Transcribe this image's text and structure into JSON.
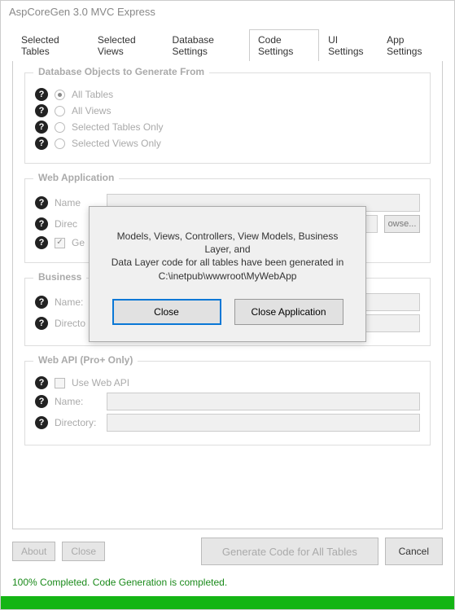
{
  "title": "AspCoreGen 3.0 MVC Express",
  "tabs": {
    "selected_tables": "Selected Tables",
    "selected_views": "Selected Views",
    "database_settings": "Database Settings",
    "code_settings": "Code Settings",
    "ui_settings": "UI Settings",
    "app_settings": "App Settings"
  },
  "group_db": {
    "title": "Database Objects to Generate From",
    "opt_all_tables": "All Tables",
    "opt_all_views": "All Views",
    "opt_sel_tables": "Selected Tables Only",
    "opt_sel_views": "Selected Views Only"
  },
  "group_web": {
    "title": "Web Application",
    "name_label": "Name",
    "dir_label": "Direc",
    "browse": "owse...",
    "gen_label": "Ge"
  },
  "group_biz": {
    "title": "Business",
    "name_label": "Name:",
    "dir_label": "Directo"
  },
  "group_api": {
    "title": "Web API (Pro+ Only)",
    "use_label": "Use Web API",
    "name_label": "Name:",
    "dir_label": "Directory:"
  },
  "footer": {
    "about": "About",
    "close": "Close",
    "generate": "Generate Code for All Tables",
    "cancel": "Cancel"
  },
  "status": "100% Completed.  Code Generation is completed.",
  "modal": {
    "line1": "Models, Views, Controllers, View Models, Business Layer, and",
    "line2": "Data Layer code for all tables have been generated in",
    "line3": "C:\\inetpub\\wwwroot\\MyWebApp",
    "close": "Close",
    "close_app": "Close Application"
  },
  "help_glyph": "?",
  "check_glyph": "✓"
}
